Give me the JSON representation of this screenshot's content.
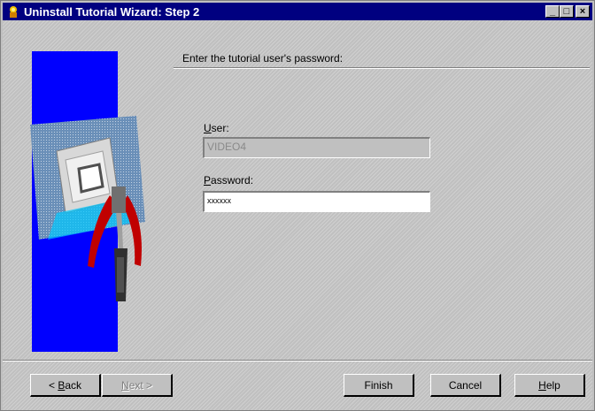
{
  "window": {
    "title": "Uninstall Tutorial Wizard: Step 2",
    "controls": {
      "minimize": "_",
      "maximize": "□",
      "close": "×"
    }
  },
  "main": {
    "prompt": "Enter the tutorial user's password:",
    "user_label_key": "U",
    "user_label_rest": "ser:",
    "user_value": "VIDEO4",
    "password_label_key": "P",
    "password_label_rest": "assword:",
    "password_value": "xxxxxx"
  },
  "buttons": {
    "back_prefix": "< ",
    "back_key": "B",
    "back_rest": "ack",
    "next_key": "N",
    "next_rest": "ext >",
    "finish": "Finish",
    "cancel": "Cancel",
    "help_key": "H",
    "help_rest": "elp"
  },
  "icons": {
    "app": "installer-icon",
    "illustration": "computer-and-tools-illustration"
  },
  "colors": {
    "titlebar": "#000080",
    "panel_blue": "#0000ff",
    "face": "#c0c0c0"
  }
}
